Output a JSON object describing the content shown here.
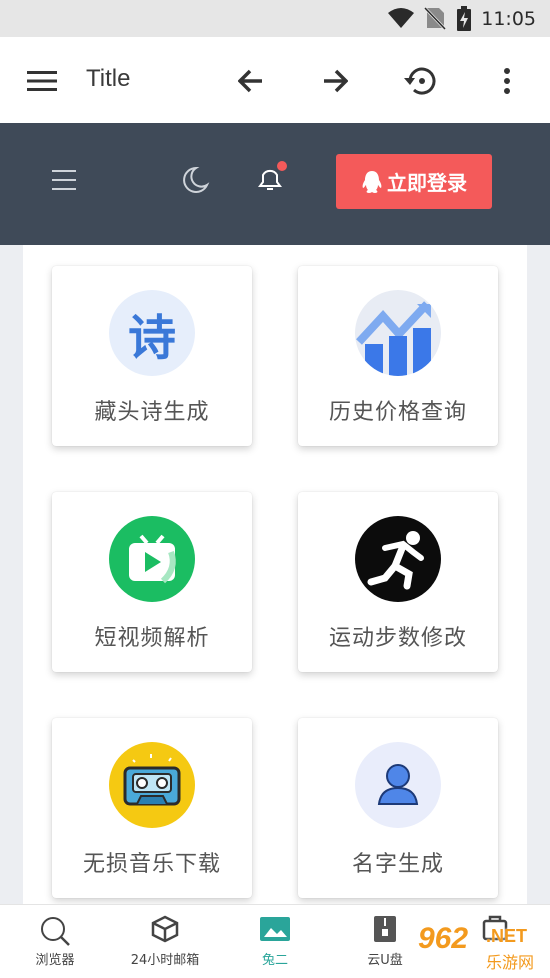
{
  "status_bar": {
    "time": "11:05"
  },
  "app_bar": {
    "title": "Title",
    "icons": [
      "menu-icon",
      "back-arrow-icon",
      "forward-arrow-icon",
      "history-icon",
      "more-vert-icon"
    ]
  },
  "header": {
    "login_label": "立即登录",
    "login_color": "#f45a5a",
    "background": "#3f4a58",
    "notification_dot_color": "#f45a5a"
  },
  "tools": [
    {
      "label": "藏头诗生成",
      "icon": "poem-icon",
      "glyph": "诗"
    },
    {
      "label": "历史价格查询",
      "icon": "price-chart-icon"
    },
    {
      "label": "短视频解析",
      "icon": "video-icon"
    },
    {
      "label": "运动步数修改",
      "icon": "runner-icon"
    },
    {
      "label": "无损音乐下载",
      "icon": "cassette-icon"
    },
    {
      "label": "名字生成",
      "icon": "person-icon"
    }
  ],
  "bottom_nav": [
    {
      "label": "浏览器",
      "icon": "search-icon"
    },
    {
      "label": "24小时邮箱",
      "icon": "box-icon"
    },
    {
      "label": "兔二",
      "icon": "image-icon",
      "active": true
    },
    {
      "label": "云U盘",
      "icon": "zip-icon"
    },
    {
      "label": "",
      "icon": "more-icon"
    }
  ],
  "watermark": {
    "brand": "962",
    "suffix": ".NET",
    "sub": "乐游网"
  }
}
